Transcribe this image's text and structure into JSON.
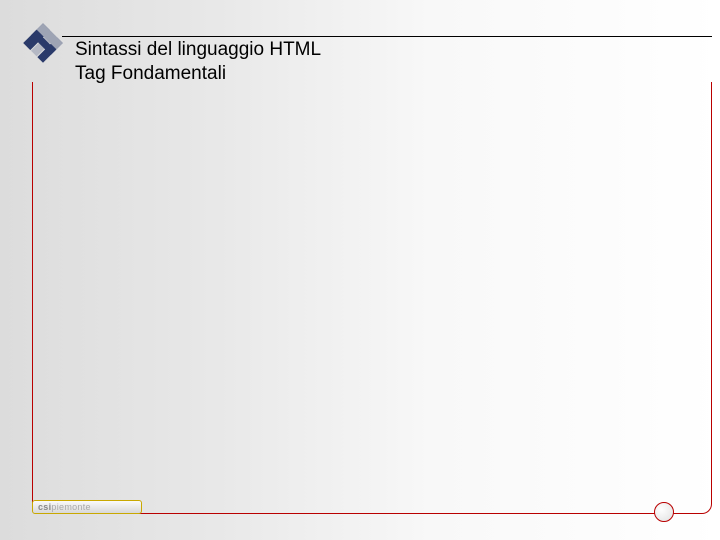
{
  "title": {
    "line1": "Sintassi del linguaggio HTML",
    "line2": "Tag Fondamentali"
  },
  "footer": {
    "brand_bold": "csi",
    "brand_light": "piemonte"
  },
  "colors": {
    "accent": "#b90000",
    "logo_side": "#2a3a6a",
    "logo_top": "#b4b8c4"
  }
}
